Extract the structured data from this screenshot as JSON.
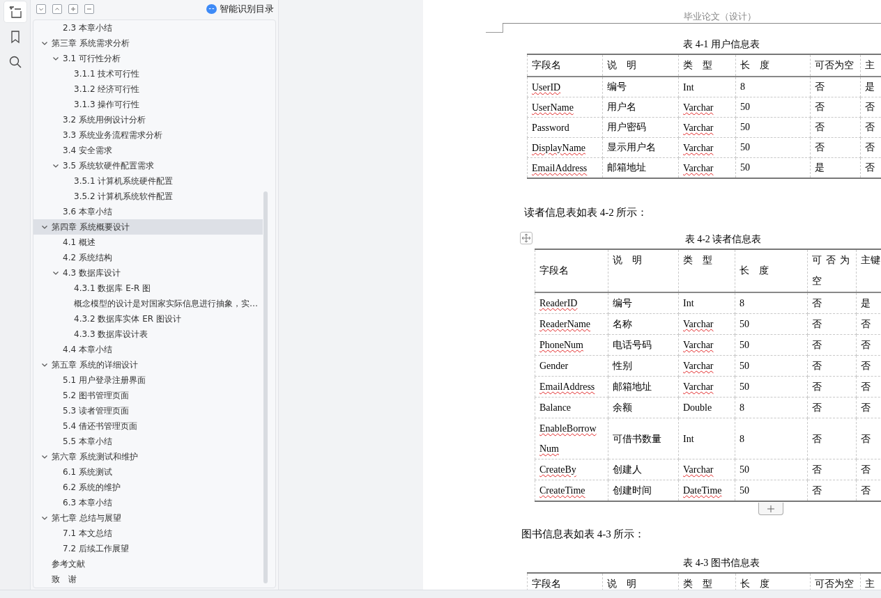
{
  "nav_rail": {
    "items": [
      {
        "kind": "outline",
        "selected": true
      },
      {
        "kind": "bookmark",
        "selected": false
      },
      {
        "kind": "search",
        "selected": false
      }
    ]
  },
  "outline_pane": {
    "toolbar": {
      "buttons": [
        {
          "kind": "expand"
        },
        {
          "kind": "collapse"
        },
        {
          "kind": "add"
        },
        {
          "kind": "remove"
        }
      ],
      "smart_toc": "智能识别目录"
    },
    "continued_items": [
      {
        "label": "2.3 本章小结",
        "selected": false
      }
    ],
    "items": [
      {
        "label": "第三章  系统需求分析",
        "selected": false,
        "expanded": true,
        "children": [
          {
            "label": "3.1 可行性分析",
            "selected": false,
            "expanded": true,
            "children": [
              {
                "label": "3.1.1 技术可行性",
                "selected": false
              },
              {
                "label": "3.1.2  经济可行性",
                "selected": false
              },
              {
                "label": "3.1.3 操作可行性",
                "selected": false
              }
            ]
          },
          {
            "label": "3.2 系统用例设计分析",
            "selected": false
          },
          {
            "label": "3.3 系统业务流程需求分析",
            "selected": false
          },
          {
            "label": "3.4 安全需求",
            "selected": false
          },
          {
            "label": "3.5 系统软硬件配置需求",
            "selected": false,
            "expanded": true,
            "children": [
              {
                "label": "3.5.1 计算机系统硬件配置",
                "selected": false
              },
              {
                "label": "3.5.2 计算机系统软件配置",
                "selected": false
              }
            ]
          },
          {
            "label": "3.6 本章小结",
            "selected": false
          }
        ]
      },
      {
        "label": "第四章  系统概要设计",
        "selected": true,
        "expanded": true,
        "children": [
          {
            "label": "4.1 概述",
            "selected": false
          },
          {
            "label": "4.2 系统结构",
            "selected": false
          },
          {
            "label": "4.3 数据库设计",
            "selected": false,
            "expanded": true,
            "children": [
              {
                "label": "4.3.1 数据库 E-R 图",
                "selected": false
              },
              {
                "label": "概念模型的设计是对国家实际信息进行抽象，实…",
                "selected": false
              },
              {
                "label": "4.3.2 数据库实体 ER 图设计",
                "selected": false
              },
              {
                "label": "4.3.3 数据库设计表",
                "selected": false
              }
            ]
          },
          {
            "label": "4.4 本章小结",
            "selected": false
          }
        ]
      },
      {
        "label": "第五章  系统的详细设计",
        "selected": false,
        "expanded": true,
        "children": [
          {
            "label": "5.1 用户登录注册界面",
            "selected": false
          },
          {
            "label": "5.2 图书管理页面",
            "selected": false
          },
          {
            "label": "5.3  读者管理页面",
            "selected": false
          },
          {
            "label": "5.4 借还书管理页面",
            "selected": false
          },
          {
            "label": "5.5 本章小结",
            "selected": false
          }
        ]
      },
      {
        "label": "第六章  系统测试和维护",
        "selected": false,
        "expanded": true,
        "children": [
          {
            "label": "6.1 系统测试",
            "selected": false
          },
          {
            "label": "6.2 系统的维护",
            "selected": false
          },
          {
            "label": "6.3 本章小结",
            "selected": false
          }
        ]
      },
      {
        "label": "第七章  总结与展望",
        "selected": false,
        "expanded": true,
        "children": [
          {
            "label": "7.1 本文总结",
            "selected": false
          },
          {
            "label": "7.2 后续工作展望",
            "selected": false
          }
        ]
      },
      {
        "label": "参考文献",
        "selected": false
      },
      {
        "label": "致　谢",
        "selected": false
      }
    ]
  },
  "document": {
    "header": "毕业论文（设计）",
    "blocks": [
      {
        "kind": "table",
        "caption": "表 4-1  用户信息表",
        "tall_header": false,
        "columns": [
          "字段名",
          "说　明",
          "类　型",
          "长　度",
          "可否为空",
          "主"
        ],
        "rows": [
          {
            "field": {
              "text": "UserID",
              "spell_error": true
            },
            "desc": "编号",
            "type": {
              "text": "Int",
              "spell_error": false
            },
            "length": "8",
            "nullable": "否",
            "key": "是"
          },
          {
            "field": {
              "text": "UserName",
              "spell_error": true
            },
            "desc": "用户名",
            "type": {
              "text": "Varchar",
              "spell_error": true
            },
            "length": "50",
            "nullable": "否",
            "key": "否"
          },
          {
            "field": {
              "text": "Password",
              "spell_error": false
            },
            "desc": "用户密码",
            "type": {
              "text": "Varchar",
              "spell_error": true
            },
            "length": "50",
            "nullable": "否",
            "key": "否"
          },
          {
            "field": {
              "text": "DisplayName",
              "spell_error": true
            },
            "desc": "显示用户名",
            "type": {
              "text": "Varchar",
              "spell_error": true
            },
            "length": "50",
            "nullable": "否",
            "key": "否"
          },
          {
            "field": {
              "text": "EmailAddress",
              "spell_error": true
            },
            "desc": "邮箱地址",
            "type": {
              "text": "Varchar",
              "spell_error": true
            },
            "length": "50",
            "nullable": "是",
            "key": "否"
          }
        ]
      },
      {
        "kind": "paragraph",
        "text": "读者信息表如表 4-2 所示："
      },
      {
        "kind": "table",
        "caption": "表 4-2  读者信息表",
        "tall_header": true,
        "move_handle": true,
        "add_row_button": true,
        "columns": [
          "字段名",
          "说　明",
          "类　型",
          "长　度",
          "可否为空",
          "主键"
        ],
        "rows": [
          {
            "field": {
              "text": "ReaderID",
              "spell_error": true
            },
            "desc": "编号",
            "type": {
              "text": "Int",
              "spell_error": false
            },
            "length": "8",
            "nullable": "否",
            "key": "是"
          },
          {
            "field": {
              "text": "ReaderName",
              "spell_error": true
            },
            "desc": "名称",
            "type": {
              "text": "Varchar",
              "spell_error": true
            },
            "length": "50",
            "nullable": "否",
            "key": "否"
          },
          {
            "field": {
              "text": "PhoneNum",
              "spell_error": true
            },
            "desc": "电话号码",
            "type": {
              "text": "Varchar",
              "spell_error": true
            },
            "length": "50",
            "nullable": "否",
            "key": "否"
          },
          {
            "field": {
              "text": "Gender",
              "spell_error": false
            },
            "desc": "性别",
            "type": {
              "text": "Varchar",
              "spell_error": true
            },
            "length": "50",
            "nullable": "否",
            "key": "否"
          },
          {
            "field": {
              "text": "EmailAddress",
              "spell_error": true
            },
            "desc": "邮箱地址",
            "type": {
              "text": "Varchar",
              "spell_error": true
            },
            "length": "50",
            "nullable": "否",
            "key": "否"
          },
          {
            "field": {
              "text": "Balance",
              "spell_error": false
            },
            "desc": "余额",
            "type": {
              "text": "Double",
              "spell_error": false
            },
            "length": "8",
            "nullable": "否",
            "key": "否"
          },
          {
            "field": {
              "text": "EnableBorrowNum",
              "spell_error": true
            },
            "desc": "可借书数量",
            "type": {
              "text": "Int",
              "spell_error": false
            },
            "length": "8",
            "nullable": "否",
            "key": "否"
          },
          {
            "field": {
              "text": "CreateBy",
              "spell_error": true
            },
            "desc": "创建人",
            "type": {
              "text": "Varchar",
              "spell_error": true
            },
            "length": "50",
            "nullable": "否",
            "key": "否"
          },
          {
            "field": {
              "text": "CreateTime",
              "spell_error": true
            },
            "desc": "创建时间",
            "type": {
              "text": "DateTime",
              "spell_error": true
            },
            "length": "50",
            "nullable": "否",
            "key": "否"
          }
        ]
      },
      {
        "kind": "paragraph",
        "text": "图书信息表如表 4-3 所示："
      },
      {
        "kind": "table",
        "caption": "表 4-3 图书信息表",
        "tall_header": false,
        "columns": [
          "字段名",
          "说　明",
          "类　型",
          "长　度",
          "可否为空",
          "主"
        ]
      }
    ]
  }
}
